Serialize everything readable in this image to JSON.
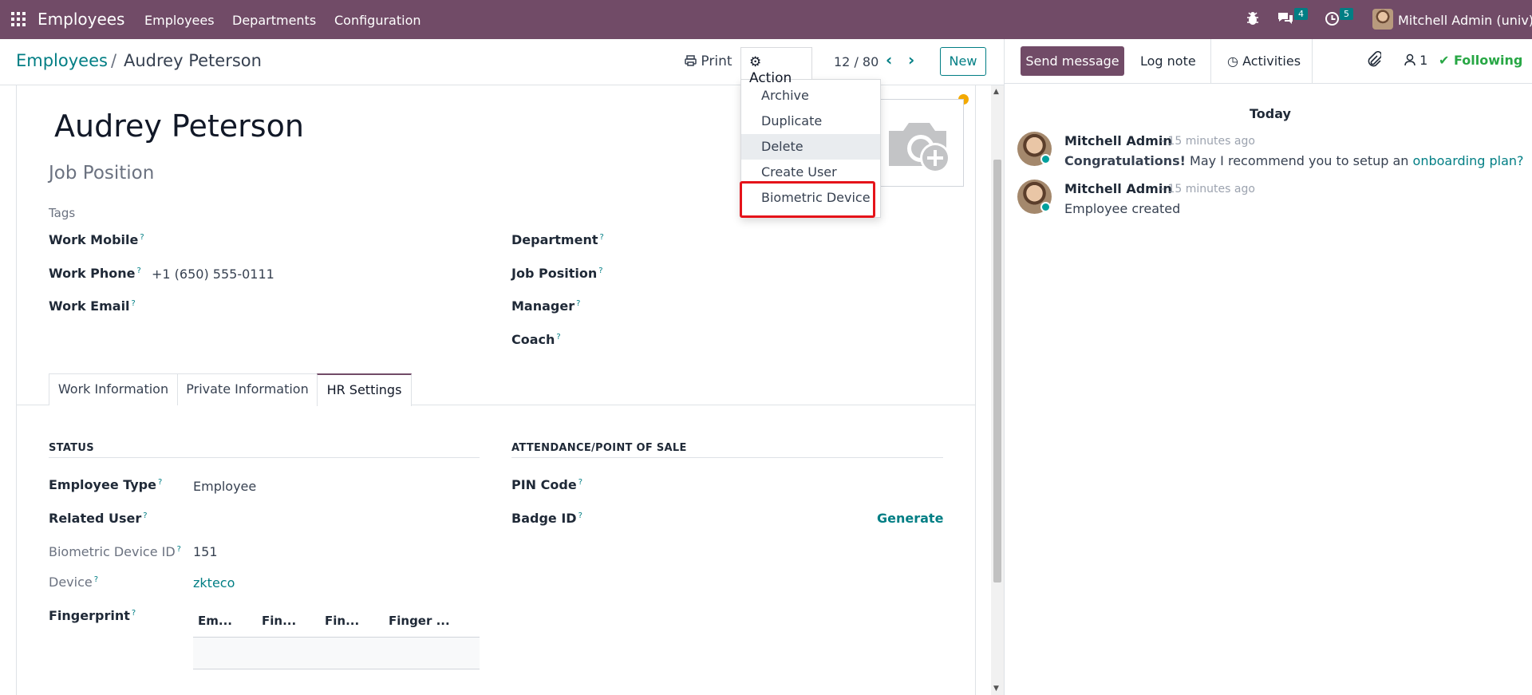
{
  "navbar": {
    "brand": "Employees",
    "menus": [
      "Employees",
      "Departments",
      "Configuration"
    ],
    "messages_count": "4",
    "activities_count": "5",
    "user": "Mitchell Admin (univ)"
  },
  "breadcrumb": {
    "parent": "Employees",
    "separator": "/",
    "current": "Audrey Peterson"
  },
  "toolbar": {
    "print_label": "Print",
    "action_label": "Action",
    "pager": "12 / 80",
    "new_label": "New"
  },
  "action_menu": {
    "items": [
      "Archive",
      "Duplicate",
      "Delete",
      "Create User",
      "Biometric Device"
    ]
  },
  "employee": {
    "name": "Audrey Peterson",
    "job_position_placeholder": "Job Position",
    "tags_placeholder": "Tags",
    "left_fields": [
      {
        "label": "Work Mobile",
        "value": ""
      },
      {
        "label": "Work Phone",
        "value": "+1 (650) 555-0111"
      },
      {
        "label": "Work Email",
        "value": ""
      }
    ],
    "right_fields": [
      {
        "label": "Department",
        "value": ""
      },
      {
        "label": "Job Position",
        "value": ""
      },
      {
        "label": "Manager",
        "value": ""
      },
      {
        "label": "Coach",
        "value": ""
      }
    ]
  },
  "tabs": [
    "Work Information",
    "Private Information",
    "HR Settings"
  ],
  "hr_settings": {
    "status_title": "STATUS",
    "attendance_title": "ATTENDANCE/POINT OF SALE",
    "employee_type_label": "Employee Type",
    "employee_type_value": "Employee",
    "related_user_label": "Related User",
    "biometric_id_label": "Biometric Device ID",
    "biometric_id_value": "151",
    "device_label": "Device",
    "device_value": "zkteco",
    "fingerprint_label": "Fingerprint",
    "fingerprint_columns": [
      "Em...",
      "Fin...",
      "Fin...",
      "Finger ..."
    ],
    "pin_label": "PIN Code",
    "badge_label": "Badge ID",
    "generate_label": "Generate"
  },
  "chatter": {
    "send_message": "Send message",
    "log_note": "Log note",
    "activities": "Activities",
    "followers_count": "1",
    "following": "Following",
    "today": "Today",
    "messages": [
      {
        "author": "Mitchell Admin",
        "time": "- 15 minutes ago",
        "bold": "Congratulations!",
        "text": " May I recommend you to setup an ",
        "link": "onboarding plan?"
      },
      {
        "author": "Mitchell Admin",
        "time": "- 15 minutes ago",
        "text": "Employee created"
      }
    ]
  },
  "colors": {
    "brand": "#714b67",
    "accent": "#017e84",
    "highlight": "#e5131a",
    "following": "#28a745"
  }
}
